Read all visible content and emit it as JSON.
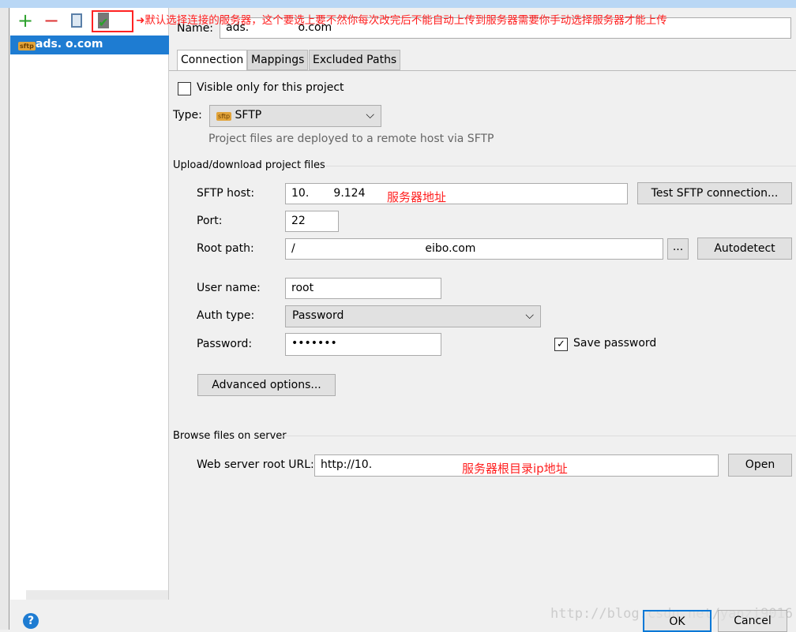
{
  "toolbar": {
    "add": "+",
    "remove": "−"
  },
  "annotations": {
    "default_server": "默认选择连接的服务器，这个要选上要不然你每次改完后不能自动上传到服务器需要你手动选择服务器才能上传",
    "host": "服务器地址",
    "url": "服务器根目录ip地址"
  },
  "sidebar": {
    "items": [
      {
        "label": "ads.          o.com",
        "icon": "sftp"
      }
    ]
  },
  "name": {
    "label": "Name:",
    "value": "ads.              o.com"
  },
  "tabs": [
    "Connection",
    "Mappings",
    "Excluded Paths"
  ],
  "visible_only": "Visible only for this project",
  "type": {
    "label": "Type:",
    "value": "SFTP",
    "icon": "sftp",
    "desc": "Project files are deployed to a remote host via SFTP"
  },
  "upload_group": "Upload/download project files",
  "host": {
    "label": "SFTP host:",
    "value": "10.       9.124",
    "test": "Test SFTP connection..."
  },
  "port": {
    "label": "Port:",
    "value": "22"
  },
  "root": {
    "label": "Root path:",
    "value": "/                                     eibo.com",
    "browse": "...",
    "autodetect": "Autodetect"
  },
  "user": {
    "label": "User name:",
    "value": "root"
  },
  "auth": {
    "label": "Auth type:",
    "value": "Password"
  },
  "password": {
    "label": "Password:",
    "value": "•••••••",
    "save": "Save password",
    "saved": true
  },
  "advanced": "Advanced options...",
  "browse_group": "Browse files on server",
  "web": {
    "label": "Web server root URL:",
    "value": "http://10.          ",
    "open": "Open"
  },
  "footer": {
    "help": "?",
    "ok": "OK",
    "cancel": "Cancel",
    "watermark": "http://blog.csdn.net/yanzi9016"
  }
}
